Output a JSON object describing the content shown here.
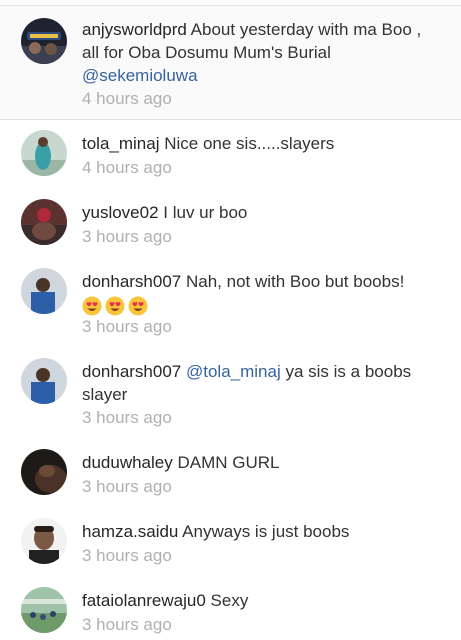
{
  "caption": {
    "username": "anjysworldprd",
    "text": " About yesterday with ma Boo , all for Oba Dosumu Mum's Burial ",
    "mention": "@sekemioluwa",
    "time": "4 hours ago"
  },
  "comments": [
    {
      "username": "tola_minaj",
      "text": " Nice one sis.....slayers",
      "time": "4 hours ago"
    },
    {
      "username": "yuslove02",
      "text": " I luv ur boo",
      "time": "3 hours ago"
    },
    {
      "username": "donharsh007",
      "text": " Nah, not with Boo but boobs!",
      "emoji": "heart-eyes-emoji",
      "time": "3 hours ago"
    },
    {
      "username": "donharsh007",
      "text_before": " ",
      "mention": "@tola_minaj",
      "text": " ya sis is a boobs slayer",
      "time": "3 hours ago"
    },
    {
      "username": "duduwhaley",
      "text": " DAMN GURL",
      "time": "3 hours ago"
    },
    {
      "username": "hamza.saidu",
      "text": " Anyways is just boobs",
      "time": "3 hours ago"
    },
    {
      "username": "fataiolanrewaju0",
      "text": " Sexy",
      "time": "3 hours ago"
    }
  ],
  "colors": {
    "mention": "#36649c",
    "timestamp": "#b0b0b0",
    "text": "#333333"
  }
}
